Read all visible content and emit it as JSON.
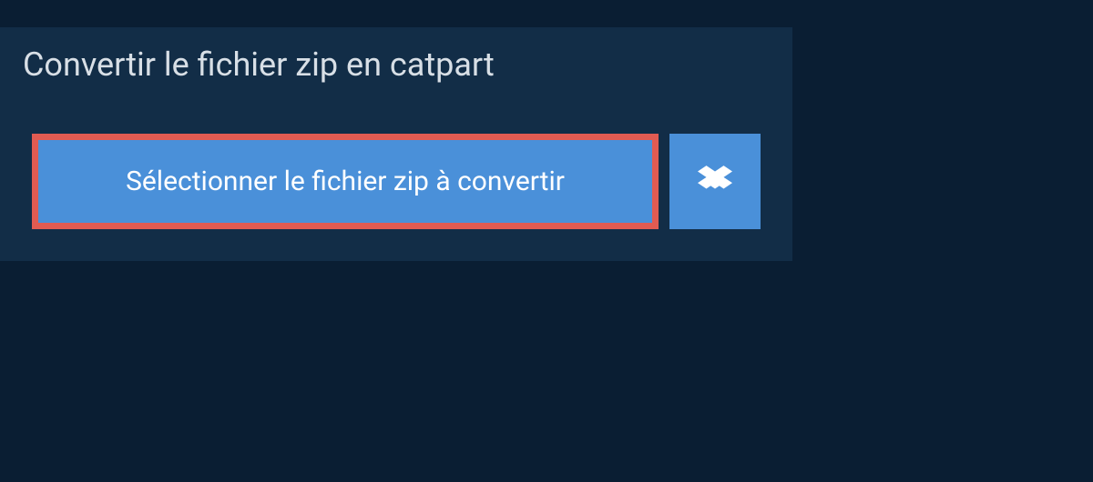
{
  "header": {
    "title": "Convertir le fichier zip en catpart"
  },
  "actions": {
    "select_file_label": "Sélectionner le fichier zip à convertir"
  }
}
